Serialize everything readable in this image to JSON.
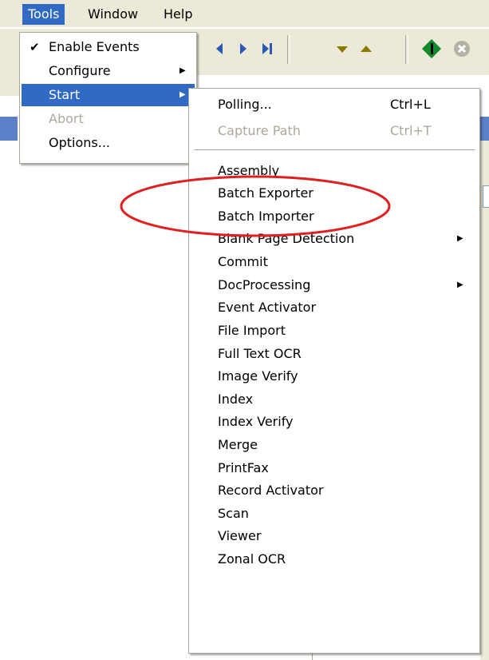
{
  "menubar": {
    "items": [
      {
        "label": "Tools"
      },
      {
        "label": "Window"
      },
      {
        "label": "Help"
      }
    ]
  },
  "tools_menu": {
    "items": [
      {
        "label": "Enable Events",
        "checked": true
      },
      {
        "label": "Configure",
        "submenu": true
      },
      {
        "label": "Start",
        "submenu": true,
        "highlighted": true
      },
      {
        "label": "Abort",
        "disabled": true
      },
      {
        "label": "Options..."
      }
    ]
  },
  "start_menu": {
    "top_items": [
      {
        "label": "Polling...",
        "shortcut": "Ctrl+L"
      },
      {
        "label": "Capture Path",
        "shortcut": "Ctrl+T",
        "disabled": true
      }
    ],
    "modules": [
      {
        "label": "Assembly"
      },
      {
        "label": "Batch Exporter"
      },
      {
        "label": "Batch Importer"
      },
      {
        "label": "Blank Page Detection",
        "submenu": true
      },
      {
        "label": "Commit"
      },
      {
        "label": "DocProcessing",
        "submenu": true
      },
      {
        "label": "Event Activator"
      },
      {
        "label": "File Import"
      },
      {
        "label": "Full Text OCR"
      },
      {
        "label": "Image Verify"
      },
      {
        "label": "Index"
      },
      {
        "label": "Index Verify"
      },
      {
        "label": "Merge"
      },
      {
        "label": "PrintFax"
      },
      {
        "label": "Record Activator"
      },
      {
        "label": "Scan"
      },
      {
        "label": "Viewer"
      },
      {
        "label": "Zonal OCR"
      }
    ]
  },
  "icons": {
    "check": "checkmark-icon",
    "submenu": "submenu-arrow-icon"
  },
  "colors": {
    "highlight": "#316ac5",
    "menubar": "#ece9d8",
    "annotation": "#e02020"
  }
}
